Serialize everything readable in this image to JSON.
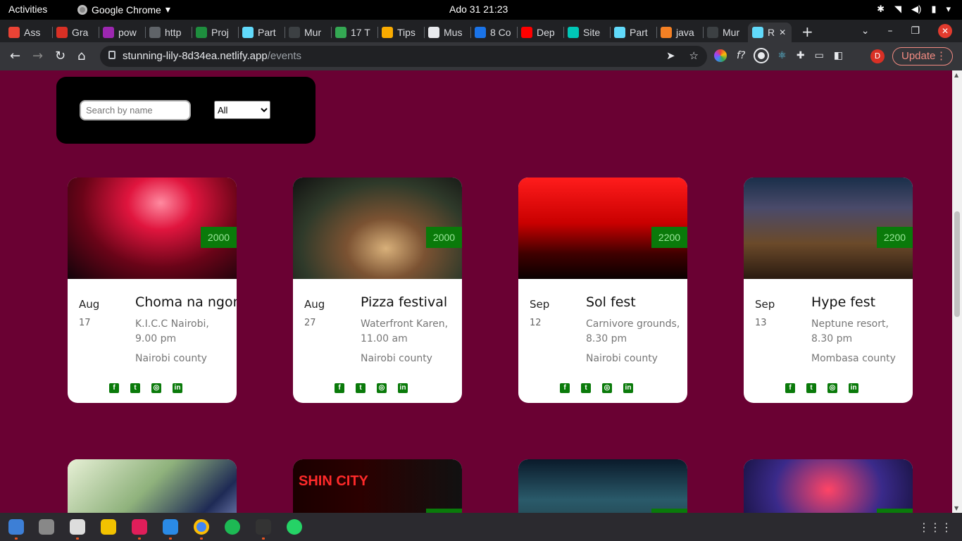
{
  "system_bar": {
    "activities": "Activities",
    "app_name": "Google Chrome",
    "app_caret": "▾",
    "clock": "Ado 31  21:23",
    "tray_icons": [
      "slack-icon",
      "wifi-icon",
      "volume-icon",
      "battery-icon",
      "power-caret-icon"
    ]
  },
  "tabs": [
    {
      "title": "Ass",
      "color": "#ea4335"
    },
    {
      "title": "Gra",
      "color": "#d93025"
    },
    {
      "title": "pow",
      "color": "#9c27b0"
    },
    {
      "title": "http",
      "color": "#5f6368"
    },
    {
      "title": "Proj",
      "color": "#1e8e3e"
    },
    {
      "title": "Part",
      "color": "#61dafb"
    },
    {
      "title": "Mur",
      "color": "#3c4043"
    },
    {
      "title": "17 T",
      "color": "#34a853"
    },
    {
      "title": "Tips",
      "color": "#f9ab00"
    },
    {
      "title": "Mus",
      "color": "#e8eaed"
    },
    {
      "title": "8 Co",
      "color": "#1a73e8"
    },
    {
      "title": "Dep",
      "color": "#ff0000"
    },
    {
      "title": "Site",
      "color": "#00c7b7"
    },
    {
      "title": "Part",
      "color": "#61dafb"
    },
    {
      "title": "java",
      "color": "#f48024"
    },
    {
      "title": "Mur",
      "color": "#3c4043"
    },
    {
      "title": "R",
      "color": "#61dafb",
      "active": true
    }
  ],
  "tab_close": "✕",
  "new_tab": "+",
  "window_controls": {
    "dropdown": "⌄",
    "minimize": "–",
    "restore": "❐",
    "close": "✕"
  },
  "toolbar": {
    "back": "←",
    "forward": "→",
    "reload": "↻",
    "home": "⌂",
    "url_host": "stunning-lily-8d34ea.netlify.app",
    "url_path": "/events",
    "send": "➤",
    "star": "☆",
    "profile_initial": "D",
    "update_label": "Update",
    "menu": "⋮"
  },
  "extensions": {
    "fx_label": "f?"
  },
  "filters": {
    "search_placeholder": "Search by name",
    "category_selected": "All"
  },
  "events": [
    {
      "price": "2000",
      "month": "Aug",
      "day": "17",
      "title": "Choma na ngoma",
      "location": "K.I.C.C Nairobi, 9.00 pm",
      "county": "Nairobi county",
      "image": "concert-crowd-red-lights"
    },
    {
      "price": "2000",
      "month": "Aug",
      "day": "27",
      "title": "Pizza festival",
      "location": "Waterfront Karen, 11.00 am",
      "county": "Nairobi county",
      "image": "woman-with-pizzas"
    },
    {
      "price": "2200",
      "month": "Sep",
      "day": "12",
      "title": "Sol fest",
      "location": "Carnivore grounds, 8.30 pm",
      "county": "Nairobi county",
      "image": "red-city-skyline-logo"
    },
    {
      "price": "2200",
      "month": "Sep",
      "day": "13",
      "title": "Hype fest",
      "location": "Neptune resort, 8.30 pm",
      "county": "Mombasa county",
      "image": "stage-tent-crowd"
    }
  ],
  "social_icons": [
    "facebook-icon",
    "twitter-icon",
    "instagram-icon",
    "linkedin-icon"
  ],
  "second_row_images": [
    "rugby-players",
    "shin-city-poster",
    "stage-tent-night",
    "jazz-stage-lights"
  ],
  "second_row_text": {
    "poster_text": "SHIN CITY"
  },
  "dock_apps": [
    "thunderbird",
    "image-viewer",
    "files",
    "rhythmbox",
    "slack",
    "vscode",
    "chrome",
    "spotify",
    "terminal",
    "whatsapp"
  ]
}
